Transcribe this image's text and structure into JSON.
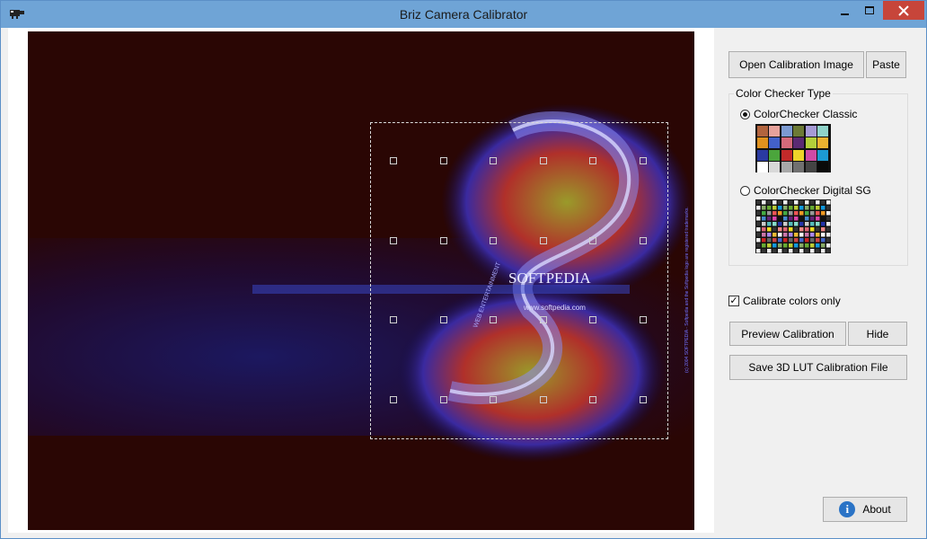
{
  "window": {
    "title": "Briz Camera Calibrator"
  },
  "photo": {
    "brand_text": "SOFTPEDIA",
    "url_text": "www.softpedia.com",
    "web_text": "WEB ENTERTAINMENT",
    "side_text": "(c) 2004 SOFTPEDIA - Softpedia and the Softpedia logo are registered trademarks."
  },
  "toolbar": {
    "open_label": "Open Calibration Image",
    "paste_label": "Paste"
  },
  "checker": {
    "group_title": "Color Checker Type",
    "classic_label": "ColorChecker Classic",
    "digital_label": "ColorChecker Digital SG",
    "selected": "classic",
    "classic_colors": [
      "#b2643e",
      "#e7a29b",
      "#7c9ad1",
      "#6c7a36",
      "#a69bd6",
      "#8fd3c9",
      "#e0921e",
      "#4361c9",
      "#d56a7a",
      "#5b2a73",
      "#b3cf3a",
      "#eab230",
      "#2a3aa1",
      "#4ba53c",
      "#c22a2a",
      "#eed429",
      "#d04aa5",
      "#1c9ad2",
      "#ffffff",
      "#d8d8d8",
      "#a8a8a8",
      "#707070",
      "#444444",
      "#0a0a0a"
    ]
  },
  "options": {
    "calibrate_label": "Calibrate colors only",
    "calibrate_checked": true
  },
  "actions": {
    "preview_label": "Preview Calibration",
    "hide_label": "Hide",
    "save_label": "Save 3D LUT Calibration File",
    "about_label": "About"
  }
}
